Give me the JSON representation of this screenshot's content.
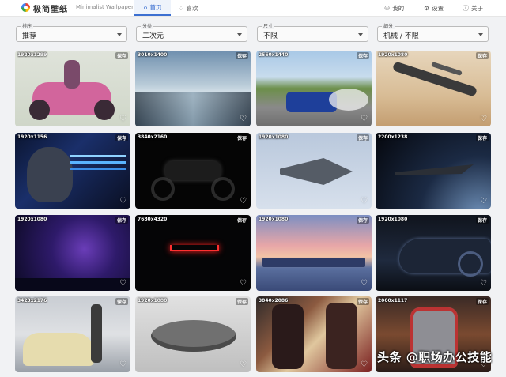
{
  "header": {
    "brand": "极简壁纸",
    "subtitle": "Minimalist Wallpaper",
    "nav": {
      "home": "首页",
      "favorites": "喜欢",
      "mine": "我的",
      "settings": "设置",
      "about": "关于"
    }
  },
  "filters": [
    {
      "label": "排序",
      "value": "推荐"
    },
    {
      "label": "分类",
      "value": "二次元"
    },
    {
      "label": "尺寸",
      "value": "不限"
    },
    {
      "label": "细分",
      "value": "机械 / 不限"
    }
  ],
  "save_label": "保存",
  "wallpapers": [
    {
      "resolution": "1920x1299",
      "subject": "anime girl on pink motorcycle"
    },
    {
      "resolution": "3010x1400",
      "subject": "icy canyon landscape"
    },
    {
      "resolution": "2560x1440",
      "subject": "blue rally car drifting"
    },
    {
      "resolution": "1920x1080",
      "subject": "spaceships over desert"
    },
    {
      "resolution": "1920x1156",
      "subject": "cyborg skull neon"
    },
    {
      "resolution": "3840x2160",
      "subject": "black motorcycle"
    },
    {
      "resolution": "1920x1080",
      "subject": "stealth fighter jet"
    },
    {
      "resolution": "2200x1238",
      "subject": "starship in orbit"
    },
    {
      "resolution": "1920x1080",
      "subject": "purple galaxy sky"
    },
    {
      "resolution": "7680x4320",
      "subject": "red neon light bar"
    },
    {
      "resolution": "1920x1080",
      "subject": "anime harbor sunset"
    },
    {
      "resolution": "1920x1080",
      "subject": "sports car in dark"
    },
    {
      "resolution": "3423x2176",
      "subject": "anime girl with retro car"
    },
    {
      "resolution": "1920x1080",
      "subject": "millennium falcon"
    },
    {
      "resolution": "3840x2086",
      "subject": "anime girls fiery"
    },
    {
      "resolution": "2000x1117",
      "subject": "gundam mecha"
    }
  ],
  "watermark": "头条 @职场办公技能",
  "colors": {
    "accent": "#3b6fd1",
    "background": "#f1f2f4"
  }
}
